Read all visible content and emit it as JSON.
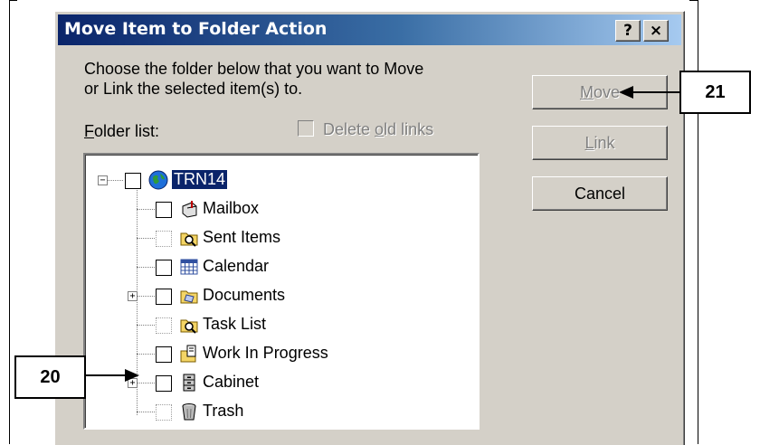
{
  "dialog": {
    "title": "Move Item to Folder Action",
    "help_button": "?",
    "close_button": "×",
    "instruction_line1": "Choose the folder below that you want to Move",
    "instruction_line2": "or Link the selected item(s) to.",
    "folder_list_label_prefix": "F",
    "folder_list_label_rest": "older list:",
    "delete_old_links_prefix": "Delete ",
    "delete_old_links_key": "o",
    "delete_old_links_rest": "ld links"
  },
  "buttons": {
    "move_prefix": "",
    "move_key": "M",
    "move_rest": "ove",
    "link_key": "L",
    "link_rest": "ink",
    "cancel": "Cancel"
  },
  "tree": {
    "root": "TRN14",
    "items": [
      {
        "label": "Mailbox",
        "icon": "mailbox-icon"
      },
      {
        "label": "Sent Items",
        "icon": "sent-items-icon"
      },
      {
        "label": "Calendar",
        "icon": "calendar-icon"
      },
      {
        "label": "Documents",
        "icon": "documents-icon"
      },
      {
        "label": "Task List",
        "icon": "task-list-icon"
      },
      {
        "label": "Work In Progress",
        "icon": "work-in-progress-icon"
      },
      {
        "label": "Cabinet",
        "icon": "cabinet-icon"
      },
      {
        "label": "Trash",
        "icon": "trash-icon"
      }
    ]
  },
  "callouts": {
    "c20": "20",
    "c21": "21"
  }
}
